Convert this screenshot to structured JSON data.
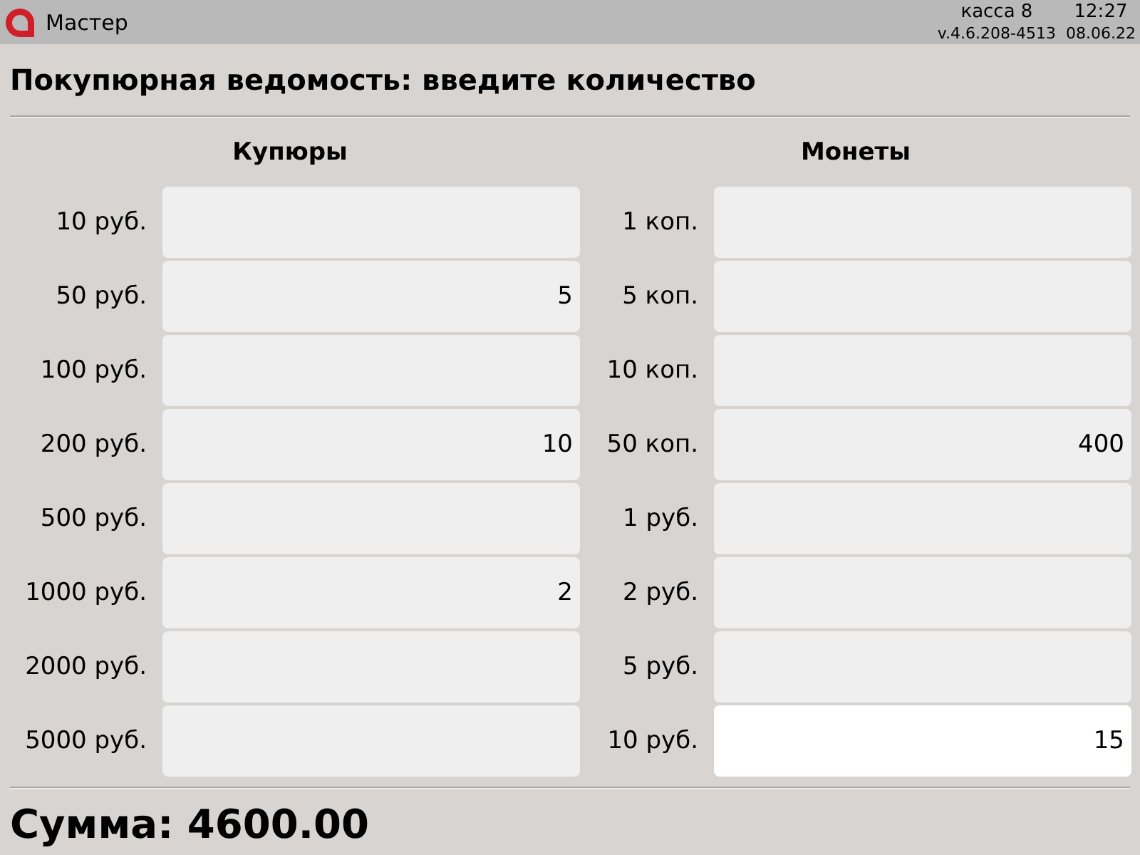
{
  "header": {
    "title": "Мастер",
    "register": "касса 8",
    "time": "12:27",
    "version": "v.4.6.208-4513",
    "date": "08.06.22"
  },
  "heading": "Покупюрная ведомость: введите количество",
  "columns": [
    {
      "title": "Купюры",
      "rows": [
        {
          "label": "10 руб.",
          "focused": false
        },
        {
          "label": "50 руб.",
          "value": "5",
          "focused": false
        },
        {
          "label": "100 руб.",
          "focused": false
        },
        {
          "label": "200 руб.",
          "value": "10",
          "focused": false
        },
        {
          "label": "500 руб.",
          "focused": false
        },
        {
          "label": "1000 руб.",
          "value": "2",
          "focused": false
        },
        {
          "label": "2000 руб.",
          "focused": false
        },
        {
          "label": "5000 руб.",
          "focused": false
        }
      ]
    },
    {
      "title": "Монеты",
      "rows": [
        {
          "label": "1 коп.",
          "focused": false
        },
        {
          "label": "5 коп.",
          "focused": false
        },
        {
          "label": "10 коп.",
          "focused": false
        },
        {
          "label": "50 коп.",
          "value": "400",
          "focused": false
        },
        {
          "label": "1 руб.",
          "focused": false
        },
        {
          "label": "2 руб.",
          "focused": false
        },
        {
          "label": "5 руб.",
          "focused": false
        },
        {
          "label": "10 руб.",
          "value": "15",
          "focused": true
        }
      ]
    }
  ],
  "total": "Сумма: 4600.00"
}
